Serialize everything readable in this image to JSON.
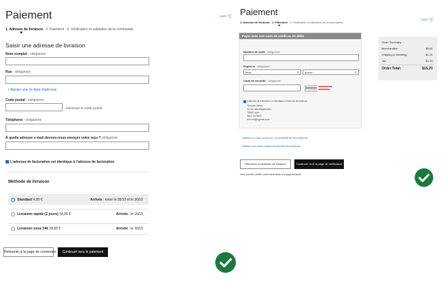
{
  "left": {
    "title": "Paiement",
    "steps": {
      "step1": "1. Adresse de livraison",
      "step2": "2. Paiement",
      "step3": "3. Vérification et validation de la commande"
    },
    "cart_label": "CART",
    "section_title": "Saisir une adresse de livraison",
    "fields": {
      "fullname": {
        "label": "Nom complet",
        "req": ": obligatoire",
        "value": ""
      },
      "street": {
        "label": "Rue",
        "req": ": obligatoire",
        "value": ""
      },
      "add_line_link": "+  Ajouter une 2e ligne d'adresse",
      "postal": {
        "label": "Code postal",
        "req": ": obligatoire",
        "value": "",
        "hint": "Saisissez le code postal"
      },
      "phone": {
        "label": "Téléphone",
        "req": ": obligatoire",
        "value": ""
      },
      "email": {
        "label": "À quelle adresse e-mail devons-nous envoyer votre reçu ?",
        "req": " obligatoire",
        "value": ""
      }
    },
    "billing_same": "L'adresse de facturation est identique à l'adresse de facturation",
    "shipping": {
      "title": "Méthode de livraison",
      "options": [
        {
          "name": "Standard",
          "price": "4,95 €",
          "arrival_label": "Arrivée",
          "arrival": " : entre le 30/10 et le 30/10",
          "selected": true
        },
        {
          "name": "Livraison rapide (2 jours)",
          "price": "14,95 €",
          "arrival_label": "Arrivée",
          "arrival": " : le 16/10",
          "selected": false
        },
        {
          "name": "Livraison sous 24h",
          "price": "29,95 €",
          "arrival_label": "Arrivée",
          "arrival": " : le 16/10",
          "selected": false
        }
      ]
    },
    "buttons": {
      "back": "Retourner à la page de connexion",
      "continue": "Continuer vers le paiement"
    }
  },
  "right": {
    "title": "Paiement",
    "steps": {
      "step1": "1. Adresse de livraison",
      "step2": "2. Paiement",
      "step3": "3. Vérification et validation de la commande"
    },
    "cart_label": "CART",
    "card_header": "Payer avec une carte de crédit ou de débit",
    "card_number": {
      "label": "Numéro de carte",
      "req": " : obligatoire",
      "value": ""
    },
    "expiry": {
      "label": "Expire le",
      "req": " : obligatoire",
      "month": "Mois",
      "year": "Année"
    },
    "cvv": {
      "label": "Code de sécurité",
      "req": " : obligatoire",
      "value": ""
    },
    "billing_same": "L'adresse de facturation est identique à l'adresse de livraison",
    "address_lines": [
      "Thomas Jolien",
      "12 rue des Mageloutes",
      "78000 Lyon",
      "0612 34 5678",
      "tom.exf@hgmail.com"
    ],
    "links": {
      "promo": "Utiliser un code promo ou un certificat de récompense",
      "gift": "Utiliser une carte-cadeau/la fournie électronique"
    },
    "buttons": {
      "back": "Retourner à l'adresse de livraison",
      "continue": "Continuer vers la page de vérification"
    },
    "note": "Vous pourrez vérifier votre commande à la page suivante.",
    "summary": {
      "title": "Order Summary",
      "rows": [
        {
          "label": "Merchandise:",
          "value": "$8.65"
        },
        {
          "label": "Shipping & Handling:",
          "value": "$4.25"
        },
        {
          "label": "Tax:",
          "value": "$1.33"
        }
      ],
      "total_label": "Order Total:",
      "total_value": "$16.20"
    }
  },
  "colors": {
    "accent_blue": "#2a68c8",
    "success_green": "#1a7a3c",
    "button_dark": "#111111"
  }
}
